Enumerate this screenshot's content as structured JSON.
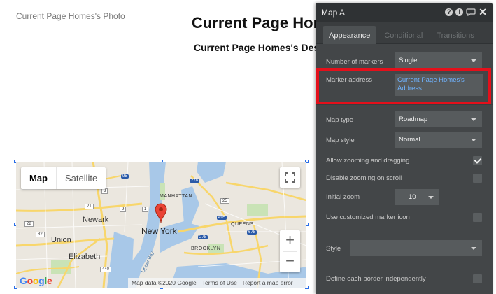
{
  "canvas": {
    "photo_text": "Current Page Homes's Photo",
    "title": "Current Page Homes's Title",
    "description": "Current Page Homes's Description"
  },
  "map": {
    "type_buttons": {
      "map": "Map",
      "satellite": "Satellite"
    },
    "zoom_in": "+",
    "zoom_out": "−",
    "google_letters": [
      "G",
      "o",
      "o",
      "g",
      "l",
      "e"
    ],
    "footer": {
      "data": "Map data ©2020 Google",
      "terms": "Terms of Use",
      "report": "Report a map error"
    },
    "labels": {
      "manhattan": "MANHATTAN",
      "new_york": "New York",
      "newark": "Newark",
      "union": "Union",
      "elizabeth": "Elizabeth",
      "queens": "QUEENS",
      "brooklyn": "BROOKLYN",
      "upper_bay": "Upper Bay",
      "hw_9": "9",
      "hw_95": "95",
      "hw_278a": "278",
      "hw_278b": "278",
      "hw_495": "495",
      "hw_678": "678",
      "hw_1": "1",
      "hw_440": "440",
      "hw_25": "25",
      "hw_22": "22",
      "hw_82": "82",
      "hw_21": "21",
      "hw_3": "3"
    },
    "colors": {
      "water": "#a8c8e8",
      "land": "#eae6df",
      "highway": "#f8d66b",
      "park": "#c9e3b6",
      "pin": "#ea4335"
    }
  },
  "panel": {
    "title": "Map A",
    "header_icons": [
      "help-icon",
      "info-icon",
      "comment-icon",
      "close-icon"
    ],
    "tabs": [
      "Appearance",
      "Conditional",
      "Transitions"
    ],
    "number_of_markers": {
      "label": "Number of markers",
      "value": "Single"
    },
    "marker_address": {
      "label": "Marker address",
      "value": "Current Page Homes's Address"
    },
    "map_type": {
      "label": "Map type",
      "value": "Roadmap"
    },
    "map_style": {
      "label": "Map style",
      "value": "Normal"
    },
    "allow_zoom": {
      "label": "Allow zooming and dragging",
      "checked": true
    },
    "disable_scroll_zoom": {
      "label": "Disable zooming on scroll",
      "checked": false
    },
    "initial_zoom": {
      "label": "Initial zoom",
      "value": "10"
    },
    "custom_marker": {
      "label": "Use customized marker icon",
      "checked": false
    },
    "style": {
      "label": "Style",
      "value": ""
    },
    "border_independent": {
      "label": "Define each border independently",
      "checked": false
    },
    "colors": {
      "panel_bg": "#434648",
      "header_bg": "#2f3234",
      "link": "#6fb3ff",
      "highlight": "#e4101b"
    }
  }
}
